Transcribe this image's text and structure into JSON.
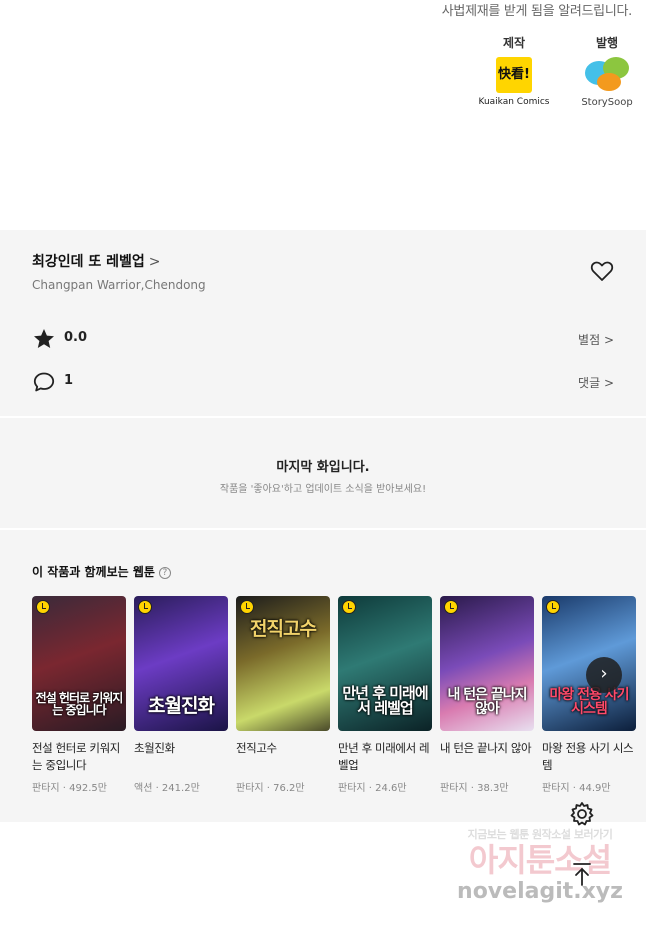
{
  "notice": "사법제재를 받게 됨을 알려드립니다.",
  "credits": {
    "production": {
      "role": "제작",
      "logo_text": "快看!",
      "caption": "Kuaikan Comics"
    },
    "publishing": {
      "role": "발행",
      "caption": "StorySoop"
    }
  },
  "info": {
    "title": "최강인데 또 레벨업",
    "title_chevron": ">",
    "authors": "Changpan Warrior,Chendong",
    "heart_icon": "heart-outline-icon",
    "rating": {
      "icon": "star-icon",
      "value": "0.0",
      "link": "별점 >"
    },
    "comments": {
      "icon": "comment-icon",
      "value": "1",
      "link": "댓글 >"
    }
  },
  "last_episode": {
    "title": "마지막 화입니다.",
    "subtitle": "작품을 '좋아요'하고 업데이트 소식을 받아보세요!"
  },
  "recommend": {
    "title": "이 작품과 함께보는 웹툰",
    "help": "?",
    "cards": [
      {
        "title": "전설 헌터로 키워지는 중입니다",
        "meta": "판타지 · 492.5만",
        "cover_text": "전설 헌터로 키워지는 중입니다"
      },
      {
        "title": "초월진화",
        "meta": "액션 · 241.2만",
        "cover_text": "초월진화"
      },
      {
        "title": "전직고수",
        "meta": "판타지 · 76.2만",
        "cover_text": "전직고수"
      },
      {
        "title": "만년 후 미래에서 레벨업",
        "meta": "판타지 · 24.6만",
        "cover_text": "만년 후 미래에서 레벨업"
      },
      {
        "title": "내 턴은 끝나지 않아",
        "meta": "판타지 · 38.3만",
        "cover_text": "내 턴은 끝나지 않아"
      },
      {
        "title": "마왕 전용 사기 시스템",
        "meta": "판타지 · 44.9만",
        "cover_text": "마왕 전용 사기 시스템"
      }
    ],
    "next_label": "›"
  },
  "floating": {
    "settings_icon": "gear-icon",
    "top_icon": "arrow-up-to-top-icon"
  },
  "watermark": {
    "line1": "지금보는 웹툰 원작소설 보러가기",
    "line2": "아지툰소설",
    "line3": "novelagit.xyz"
  }
}
